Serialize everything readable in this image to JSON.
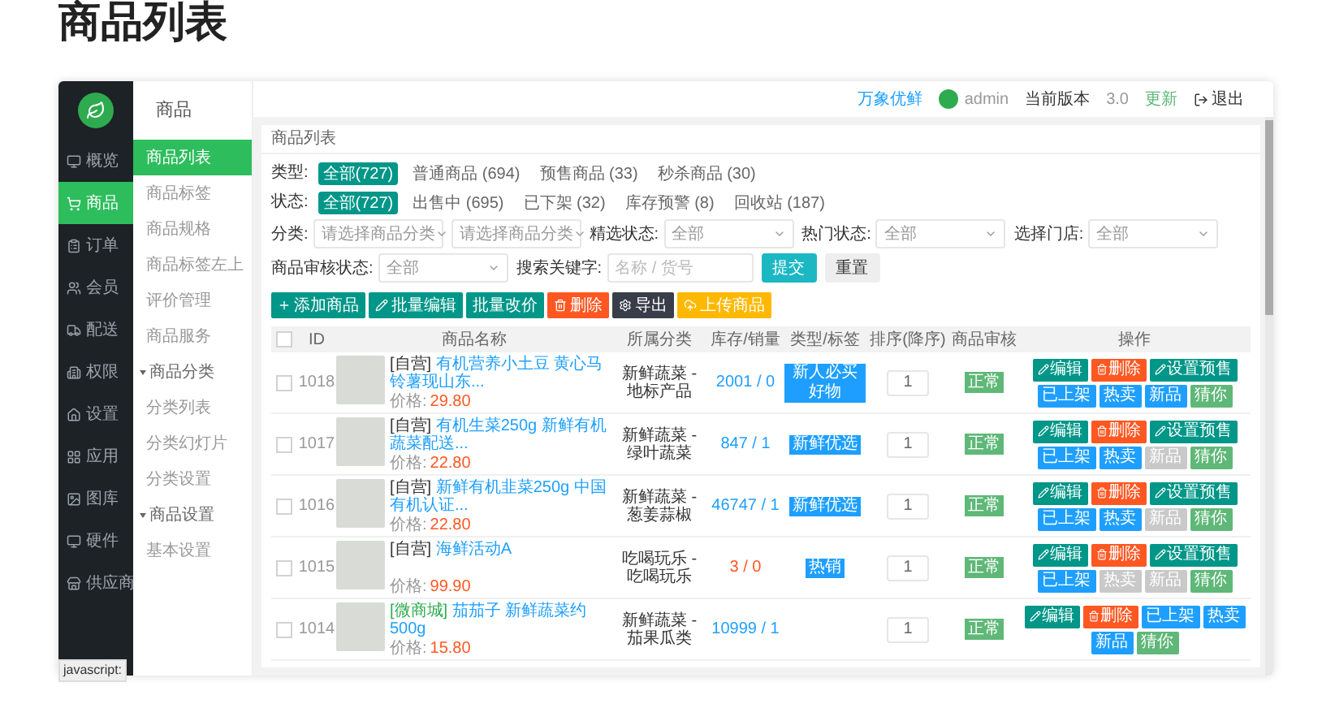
{
  "page_title": "商品列表",
  "sidebar": {
    "items": [
      {
        "label": "概览",
        "selected": false
      },
      {
        "label": "商品",
        "selected": true
      },
      {
        "label": "订单",
        "selected": false
      },
      {
        "label": "会员",
        "selected": false
      },
      {
        "label": "配送",
        "selected": false
      },
      {
        "label": "权限",
        "selected": false
      },
      {
        "label": "设置",
        "selected": false
      },
      {
        "label": "应用",
        "selected": false
      },
      {
        "label": "图库",
        "selected": false
      },
      {
        "label": "硬件",
        "selected": false
      },
      {
        "label": "供应商",
        "selected": false
      }
    ]
  },
  "submenu": {
    "title": "商品",
    "items": [
      {
        "kind": "link",
        "label": "商品列表",
        "selected": true
      },
      {
        "kind": "link",
        "label": "商品标签",
        "selected": false
      },
      {
        "kind": "link",
        "label": "商品规格",
        "selected": false
      },
      {
        "kind": "link",
        "label": "商品标签左上",
        "selected": false
      },
      {
        "kind": "link",
        "label": "评价管理",
        "selected": false
      },
      {
        "kind": "link",
        "label": "商品服务",
        "selected": false
      },
      {
        "kind": "group",
        "label": "商品分类",
        "expanded": true,
        "children": [
          {
            "label": "分类列表",
            "selected": false
          },
          {
            "label": "分类幻灯片",
            "selected": false
          },
          {
            "label": "分类设置",
            "selected": false
          }
        ]
      },
      {
        "kind": "group",
        "label": "商品设置",
        "expanded": true,
        "children": [
          {
            "label": "基本设置",
            "selected": false
          }
        ]
      }
    ]
  },
  "header": {
    "shop_link": "万象优鲜",
    "user": "admin",
    "version_label": "当前版本",
    "version": "3.0",
    "update_link": "更新",
    "logout": "退出"
  },
  "panel_title": "商品列表",
  "option_filters": [
    {
      "label": "类型:",
      "options": [
        {
          "label": "全部(727)",
          "selected": true
        },
        {
          "label": "普通商品 (694)",
          "selected": false
        },
        {
          "label": "预售商品 (33)",
          "selected": false
        },
        {
          "label": "秒杀商品 (30)",
          "selected": false
        }
      ]
    },
    {
      "label": "状态:",
      "options": [
        {
          "label": "全部(727)",
          "selected": true
        },
        {
          "label": "出售中 (695)",
          "selected": false
        },
        {
          "label": "已下架 (32)",
          "selected": false
        },
        {
          "label": "库存预警 (8)",
          "selected": false
        },
        {
          "label": "回收站 (187)",
          "selected": false
        }
      ]
    }
  ],
  "filter_rows": [
    [
      {
        "kind": "select",
        "label": "分类:",
        "placeholder": "请选择商品分类"
      },
      {
        "kind": "select",
        "placeholder": "请选择商品分类"
      },
      {
        "kind": "select",
        "label": "精选状态:",
        "value": "全部"
      },
      {
        "kind": "select",
        "label": "热门状态:",
        "value": "全部"
      },
      {
        "kind": "select",
        "label": "选择门店:",
        "value": "全部"
      }
    ],
    [
      {
        "kind": "select",
        "label": "商品审核状态:",
        "value": "全部"
      },
      {
        "kind": "input",
        "label": "搜索关键字:",
        "placeholder": "名称 / 货号"
      },
      {
        "kind": "submit",
        "label": "提交"
      },
      {
        "kind": "reset",
        "label": "重置"
      }
    ]
  ],
  "toolbar": [
    {
      "kind": "add",
      "label": "添加商品"
    },
    {
      "kind": "batch_edit",
      "label": "批量编辑"
    },
    {
      "kind": "batch_price",
      "label": "批量改价"
    },
    {
      "kind": "delete",
      "label": "删除"
    },
    {
      "kind": "export",
      "label": "导出"
    },
    {
      "kind": "upload",
      "label": "上传商品"
    }
  ],
  "table": {
    "select_all_checked": false,
    "columns": [
      "ID",
      "商品名称",
      "所属分类",
      "库存/销量",
      "类型/标签",
      "排序(降序)",
      "商品审核",
      "操作"
    ],
    "rows": [
      {
        "checked": false,
        "id": "1018",
        "store": "[自营]",
        "store_highlighted": false,
        "name": "有机营养小土豆 黄心马铃薯现山东...",
        "price_label": "价格:",
        "price": "29.80",
        "category": "新鲜蔬菜 - 地标产品",
        "stock_sales": "2001 / 0",
        "stock_low": false,
        "tags": [
          "新人必买好物"
        ],
        "sort": "1",
        "audit": "正常",
        "actions": [
          {
            "kind": "edit",
            "label": "编辑"
          },
          {
            "kind": "delete",
            "label": "删除"
          },
          {
            "kind": "presale",
            "label": "设置预售"
          },
          {
            "kind": "listed",
            "label": "已上架"
          },
          {
            "kind": "toggle",
            "label": "热卖",
            "on": true
          },
          {
            "kind": "toggle",
            "label": "新品",
            "on": true
          },
          {
            "kind": "recommend",
            "label": "猜你"
          }
        ]
      },
      {
        "checked": false,
        "id": "1017",
        "store": "[自营]",
        "store_highlighted": false,
        "name": "有机生菜250g 新鲜有机蔬菜配送...",
        "price_label": "价格:",
        "price": "22.80",
        "category": "新鲜蔬菜 - 绿叶蔬菜",
        "stock_sales": "847 / 1",
        "stock_low": false,
        "tags": [
          "新鲜优选"
        ],
        "sort": "1",
        "audit": "正常",
        "actions": [
          {
            "kind": "edit",
            "label": "编辑"
          },
          {
            "kind": "delete",
            "label": "删除"
          },
          {
            "kind": "presale",
            "label": "设置预售"
          },
          {
            "kind": "listed",
            "label": "已上架"
          },
          {
            "kind": "toggle",
            "label": "热卖",
            "on": true
          },
          {
            "kind": "toggle",
            "label": "新品",
            "on": false
          },
          {
            "kind": "recommend",
            "label": "猜你"
          }
        ]
      },
      {
        "checked": false,
        "id": "1016",
        "store": "[自营]",
        "store_highlighted": false,
        "name": "新鲜有机韭菜250g 中国有机认证...",
        "price_label": "价格:",
        "price": "22.80",
        "category": "新鲜蔬菜 - 葱姜蒜椒",
        "stock_sales": "46747 / 1",
        "stock_low": false,
        "tags": [
          "新鲜优选"
        ],
        "sort": "1",
        "audit": "正常",
        "actions": [
          {
            "kind": "edit",
            "label": "编辑"
          },
          {
            "kind": "delete",
            "label": "删除"
          },
          {
            "kind": "presale",
            "label": "设置预售"
          },
          {
            "kind": "listed",
            "label": "已上架"
          },
          {
            "kind": "toggle",
            "label": "热卖",
            "on": true
          },
          {
            "kind": "toggle",
            "label": "新品",
            "on": false
          },
          {
            "kind": "recommend",
            "label": "猜你"
          }
        ]
      },
      {
        "checked": false,
        "id": "1015",
        "store": "[自营]",
        "store_highlighted": false,
        "name": "海鲜活动A",
        "price_label": "价格:",
        "price": "99.90",
        "category": "吃喝玩乐 - 吃喝玩乐",
        "stock_sales": "3 / 0",
        "stock_low": true,
        "tags": [
          "热销"
        ],
        "sort": "1",
        "audit": "正常",
        "actions": [
          {
            "kind": "edit",
            "label": "编辑"
          },
          {
            "kind": "delete",
            "label": "删除"
          },
          {
            "kind": "presale",
            "label": "设置预售"
          },
          {
            "kind": "listed",
            "label": "已上架"
          },
          {
            "kind": "toggle",
            "label": "热卖",
            "on": false
          },
          {
            "kind": "toggle",
            "label": "新品",
            "on": false
          },
          {
            "kind": "recommend",
            "label": "猜你"
          }
        ]
      },
      {
        "checked": false,
        "id": "1014",
        "store": "[微商城]",
        "store_highlighted": true,
        "name": "茄茄子 新鲜蔬菜约500g",
        "price_label": "价格:",
        "price": "15.80",
        "category": "新鲜蔬菜 - 茄果瓜类",
        "stock_sales": "10999 / 1",
        "stock_low": false,
        "tags": [],
        "sort": "1",
        "audit": "正常",
        "actions": [
          {
            "kind": "edit",
            "label": "编辑"
          },
          {
            "kind": "delete",
            "label": "删除"
          },
          {
            "kind": "listed",
            "label": "已上架"
          },
          {
            "kind": "toggle",
            "label": "热卖",
            "on": true
          },
          {
            "kind": "toggle",
            "label": "新品",
            "on": true
          },
          {
            "kind": "recommend",
            "label": "猜你"
          }
        ]
      }
    ]
  },
  "status_bar": "javascript:"
}
